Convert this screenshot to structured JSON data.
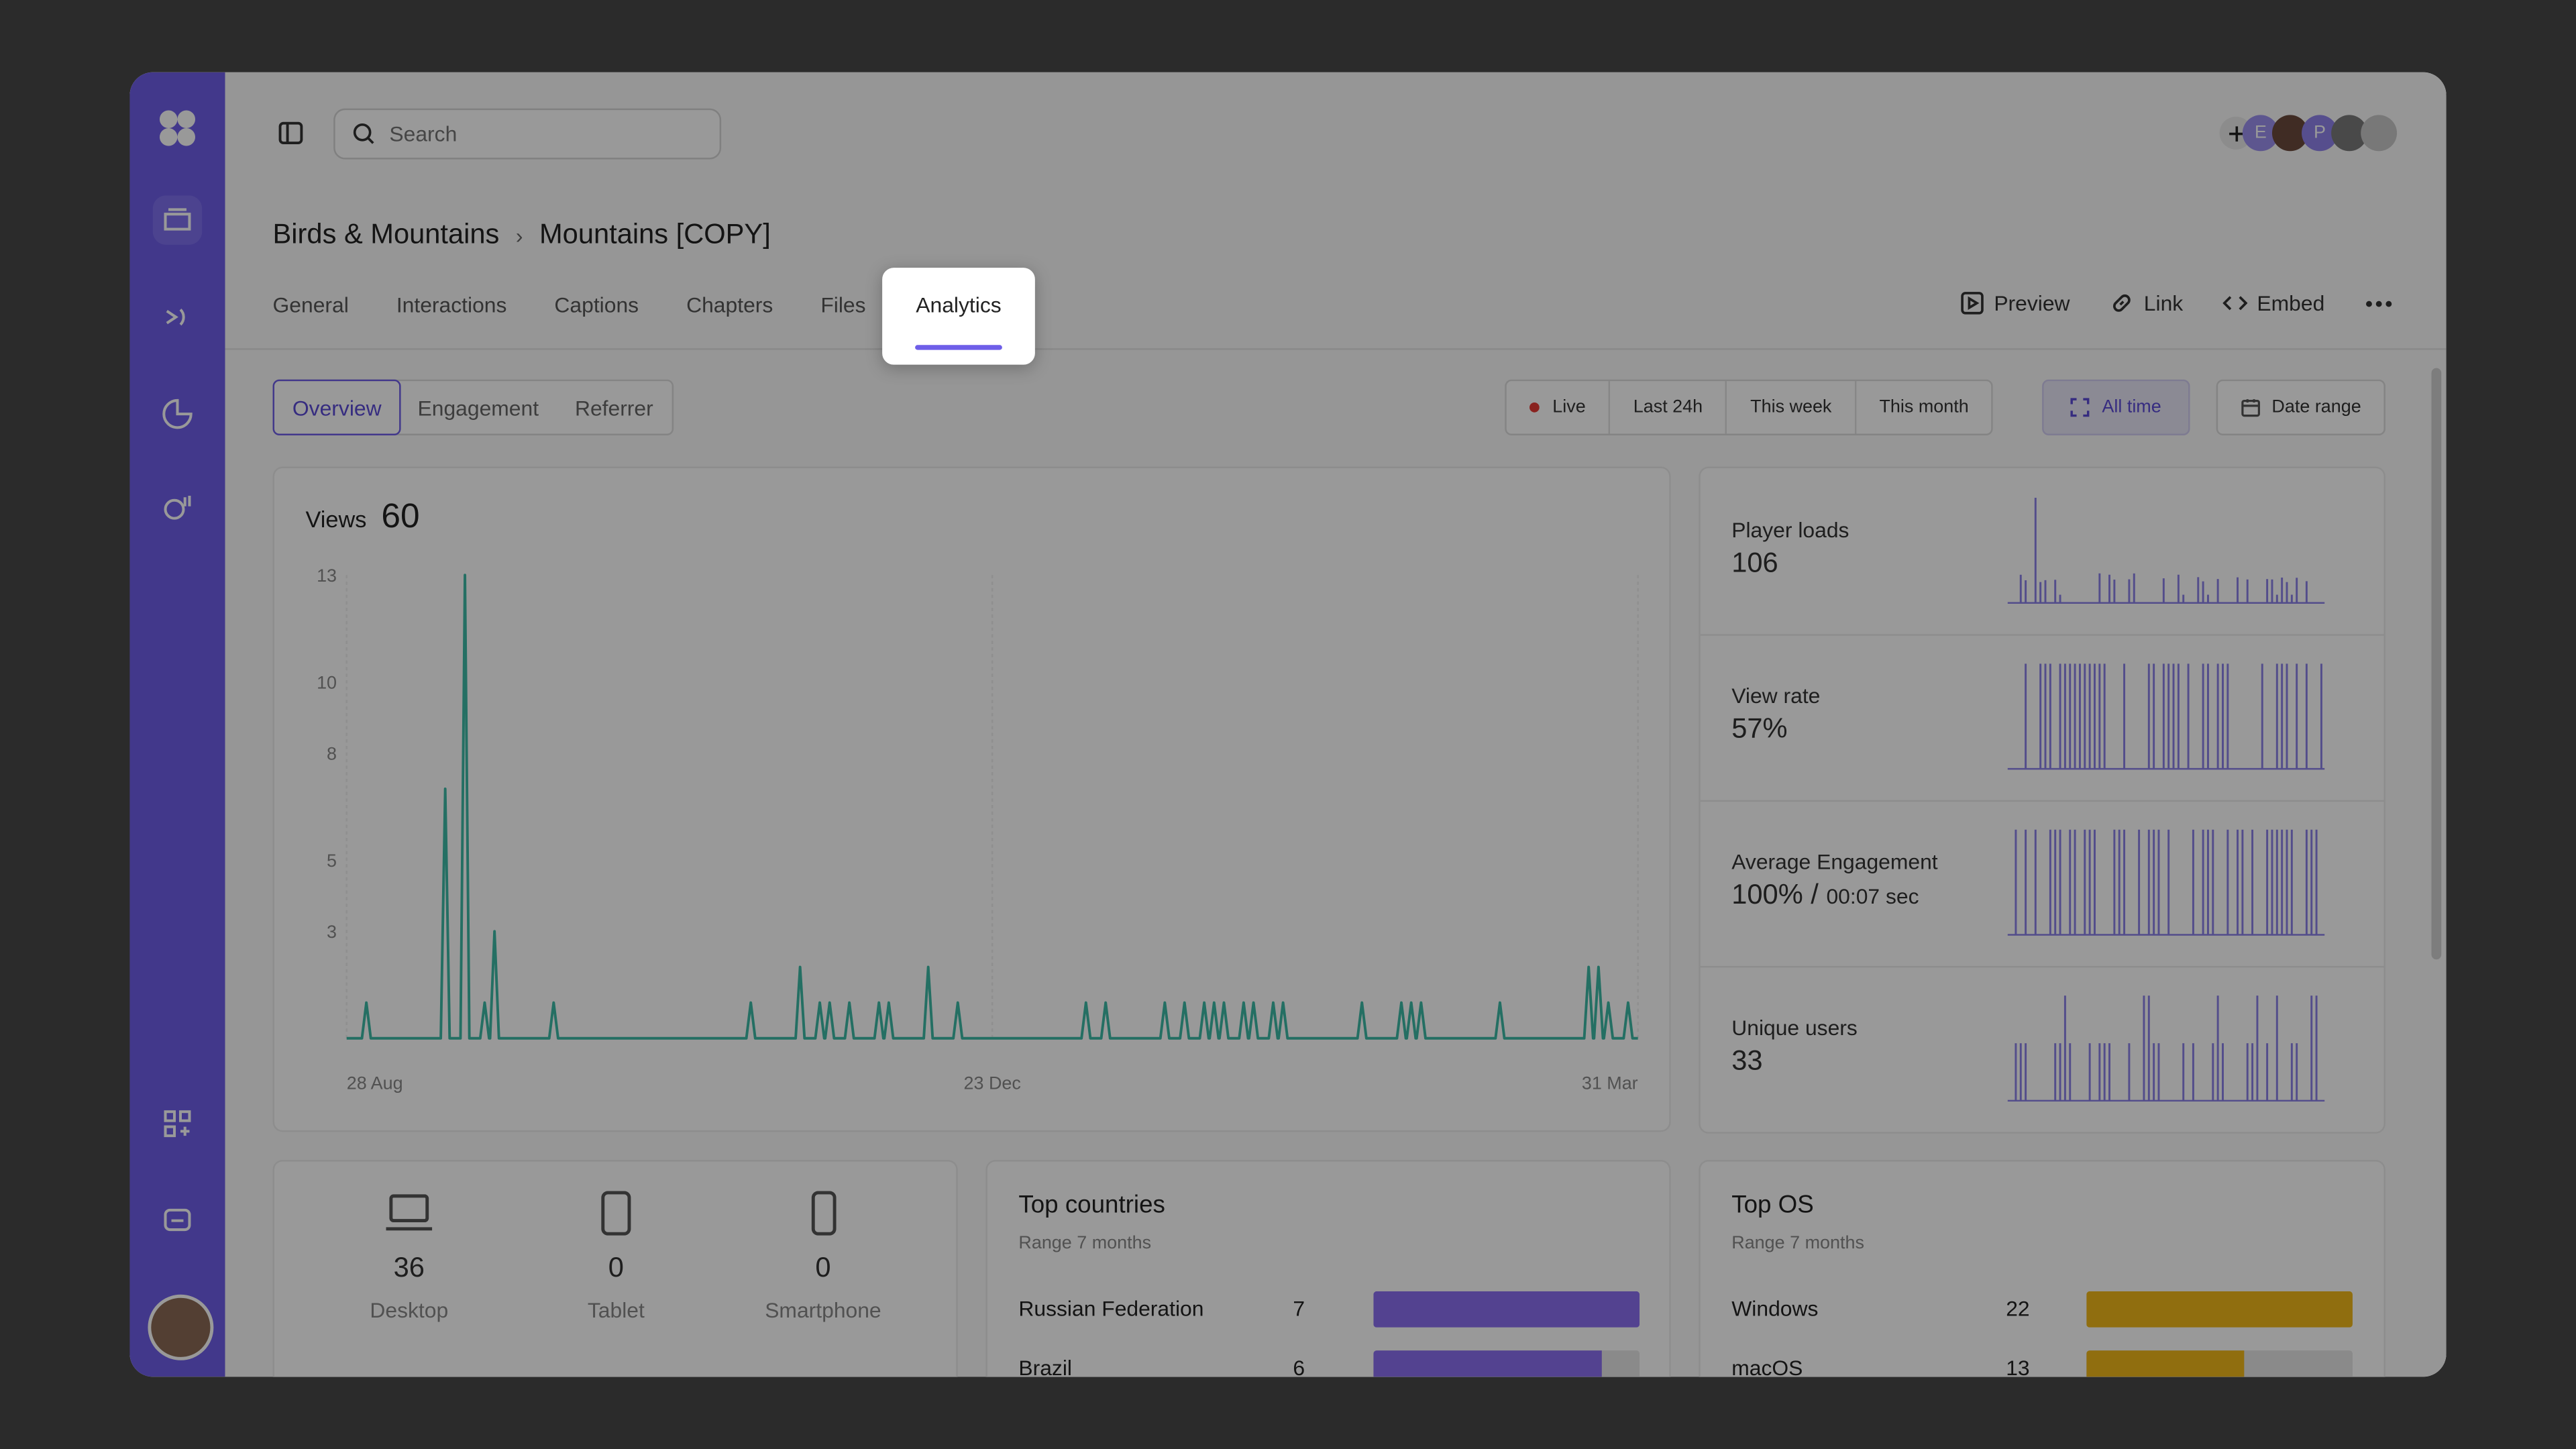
{
  "search": {
    "placeholder": "Search"
  },
  "breadcrumb": {
    "parent": "Birds & Mountains",
    "current": "Mountains [COPY]"
  },
  "tabs": [
    {
      "label": "General"
    },
    {
      "label": "Interactions"
    },
    {
      "label": "Captions"
    },
    {
      "label": "Chapters"
    },
    {
      "label": "Files"
    },
    {
      "label": "Analytics",
      "active": true
    }
  ],
  "actions": {
    "preview": "Preview",
    "link": "Link",
    "embed": "Embed"
  },
  "subtabs": [
    {
      "label": "Overview",
      "selected": true
    },
    {
      "label": "Engagement"
    },
    {
      "label": "Referrer"
    }
  ],
  "ranges": {
    "live": "Live",
    "last24h": "Last 24h",
    "week": "This week",
    "month": "This month",
    "alltime": "All time",
    "date_range": "Date range"
  },
  "collaborators": [
    "E",
    "P"
  ],
  "views": {
    "label": "Views",
    "total": "60"
  },
  "chart_data": {
    "type": "line",
    "title": "Views",
    "yticks": [
      "13",
      "10",
      "8",
      "5",
      "3"
    ],
    "xticks": [
      "28 Aug",
      "23 Dec",
      "31 Mar"
    ],
    "ylim": [
      0,
      13
    ],
    "series": [
      {
        "values": [
          0,
          0,
          1,
          0,
          0,
          0,
          0,
          0,
          0,
          0,
          7,
          0,
          13,
          0,
          1,
          3,
          0,
          0,
          0,
          0,
          0,
          1,
          0,
          0,
          0,
          0,
          0,
          0,
          0,
          0,
          0,
          0,
          0,
          0,
          0,
          0,
          0,
          0,
          0,
          0,
          0,
          1,
          0,
          0,
          0,
          0,
          2,
          0,
          1,
          1,
          0,
          1,
          0,
          0,
          1,
          1,
          0,
          0,
          0,
          2,
          0,
          0,
          1,
          0,
          0,
          0,
          0,
          0,
          0,
          0,
          0,
          0,
          0,
          0,
          0,
          1,
          0,
          1,
          0,
          0,
          0,
          0,
          0,
          1,
          0,
          1,
          0,
          1,
          1,
          1,
          0,
          1,
          1,
          0,
          1,
          1,
          0,
          0,
          0,
          0,
          0,
          0,
          0,
          1,
          0,
          0,
          0,
          1,
          1,
          1,
          0,
          0,
          0,
          0,
          0,
          0,
          0,
          1,
          0,
          0,
          0,
          0,
          0,
          0,
          0,
          0,
          2,
          2,
          1,
          0,
          1,
          0
        ]
      }
    ],
    "color": "#3cb9a6"
  },
  "metrics": [
    {
      "label": "Player loads",
      "value": "106"
    },
    {
      "label": "View rate",
      "value": "57%"
    },
    {
      "label": "Average Engagement",
      "value": "100%",
      "extra": "00:07 sec"
    },
    {
      "label": "Unique users",
      "value": "33"
    }
  ],
  "devices": [
    {
      "label": "Desktop",
      "count": "36",
      "icon": "laptop-icon"
    },
    {
      "label": "Tablet",
      "count": "0",
      "icon": "tablet-icon"
    },
    {
      "label": "Smartphone",
      "count": "0",
      "icon": "smartphone-icon"
    }
  ],
  "top_countries": {
    "title": "Top countries",
    "subtitle": "Range 7 months",
    "rows": [
      {
        "name": "Russian Federation",
        "count": "7",
        "fraction": 1.0
      },
      {
        "name": "Brazil",
        "count": "6",
        "fraction": 0.86
      }
    ]
  },
  "top_os": {
    "title": "Top OS",
    "subtitle": "Range 7 months",
    "rows": [
      {
        "name": "Windows",
        "count": "22",
        "fraction": 1.0
      },
      {
        "name": "macOS",
        "count": "13",
        "fraction": 0.59
      }
    ]
  },
  "colors": {
    "accent": "#6e5ee8",
    "chart": "#3cb9a6",
    "os_bar": "#f0b81a",
    "country_bar": "#8a6ef0"
  }
}
